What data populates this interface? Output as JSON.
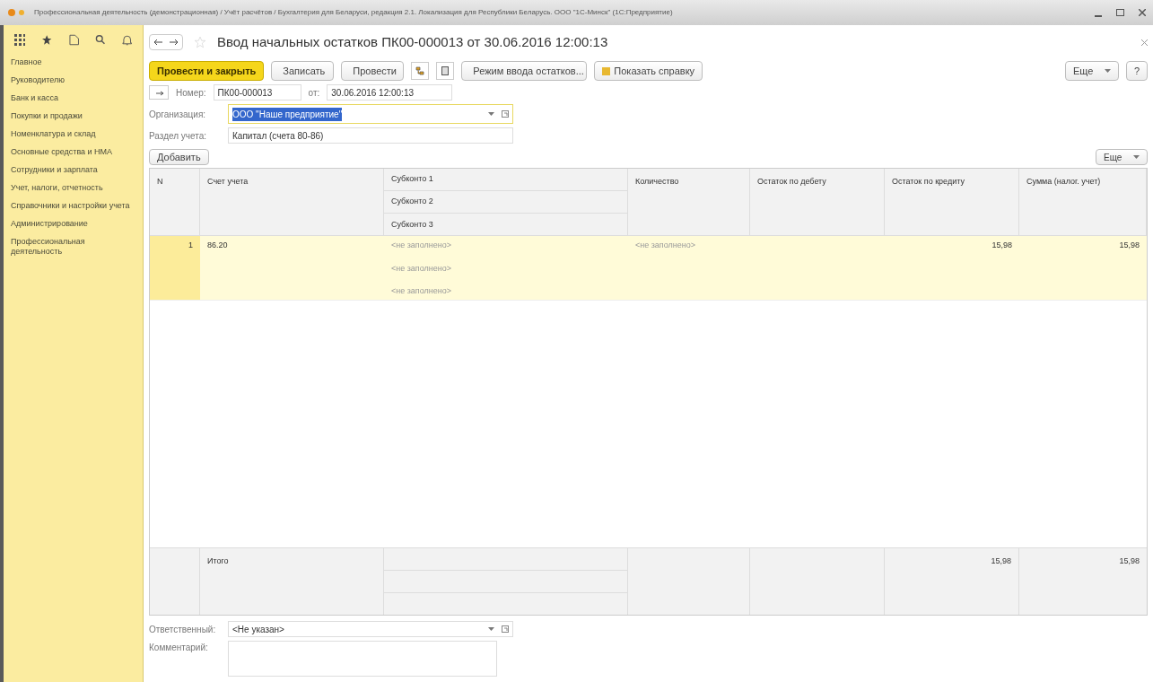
{
  "window": {
    "title": "Профессиональная деятельность (демонстрационная) / Учёт расчётов / Бухгалтерия для Беларуси, редакция 2.1. Локализация для Республики Беларусь. ООО \"1С-Минск\" (1С:Предприятие)"
  },
  "sidebar": {
    "items": [
      {
        "label": "Главное"
      },
      {
        "label": "Руководителю"
      },
      {
        "label": "Банк и касса"
      },
      {
        "label": "Покупки и продажи"
      },
      {
        "label": "Номенклатура и склад"
      },
      {
        "label": "Основные средства и НМА"
      },
      {
        "label": "Сотрудники и зарплата"
      },
      {
        "label": "Учет, налоги, отчетность"
      },
      {
        "label": "Справочники и настройки учета"
      },
      {
        "label": "Администрирование"
      },
      {
        "label": "Профессиональная деятельность"
      }
    ]
  },
  "document": {
    "title": "Ввод начальных остатков ПК00-000013 от 30.06.2016 12:00:13",
    "toolbar": {
      "post_close": "Провести и закрыть",
      "save": "Записать",
      "post": "Провести",
      "mode": "Режим ввода остатков...",
      "help": "Показать справку",
      "more": "Еще",
      "question": "?"
    },
    "number": {
      "label": "Номер:",
      "value": "ПК00-000013"
    },
    "date": {
      "label": "от:",
      "value": "30.06.2016 12:00:13"
    },
    "organization": {
      "label": "Организация:",
      "value": "ООО \"Наше предприятие\"",
      "selected": true
    },
    "section": {
      "label": "Раздел учета:",
      "value": "Капитал (счета 80-86)"
    },
    "table": {
      "add": "Добавить",
      "more": "Еще",
      "columns": [
        "N",
        "Счет учета",
        "Субконто 1",
        "Субконто 2",
        "Субконто 3",
        "Количество",
        "Остаток по дебету",
        "Остаток по кредиту",
        "Сумма (налог. учет)"
      ],
      "rows": [
        {
          "n": "1",
          "account": "86.20",
          "subconto": [
            "<не заполнено>",
            "<не заполнено>",
            "<не заполнено>"
          ],
          "quantity": "<не заполнено>",
          "debit": "",
          "credit": "15,98",
          "sum": "15,98",
          "selected": true
        }
      ],
      "total": {
        "label": "Итого",
        "credit": "15,98",
        "sum": "15,98"
      }
    },
    "responsible": {
      "label": "Ответственный:",
      "value": "<Не указан>"
    },
    "comment": {
      "label": "Комментарий:"
    }
  }
}
